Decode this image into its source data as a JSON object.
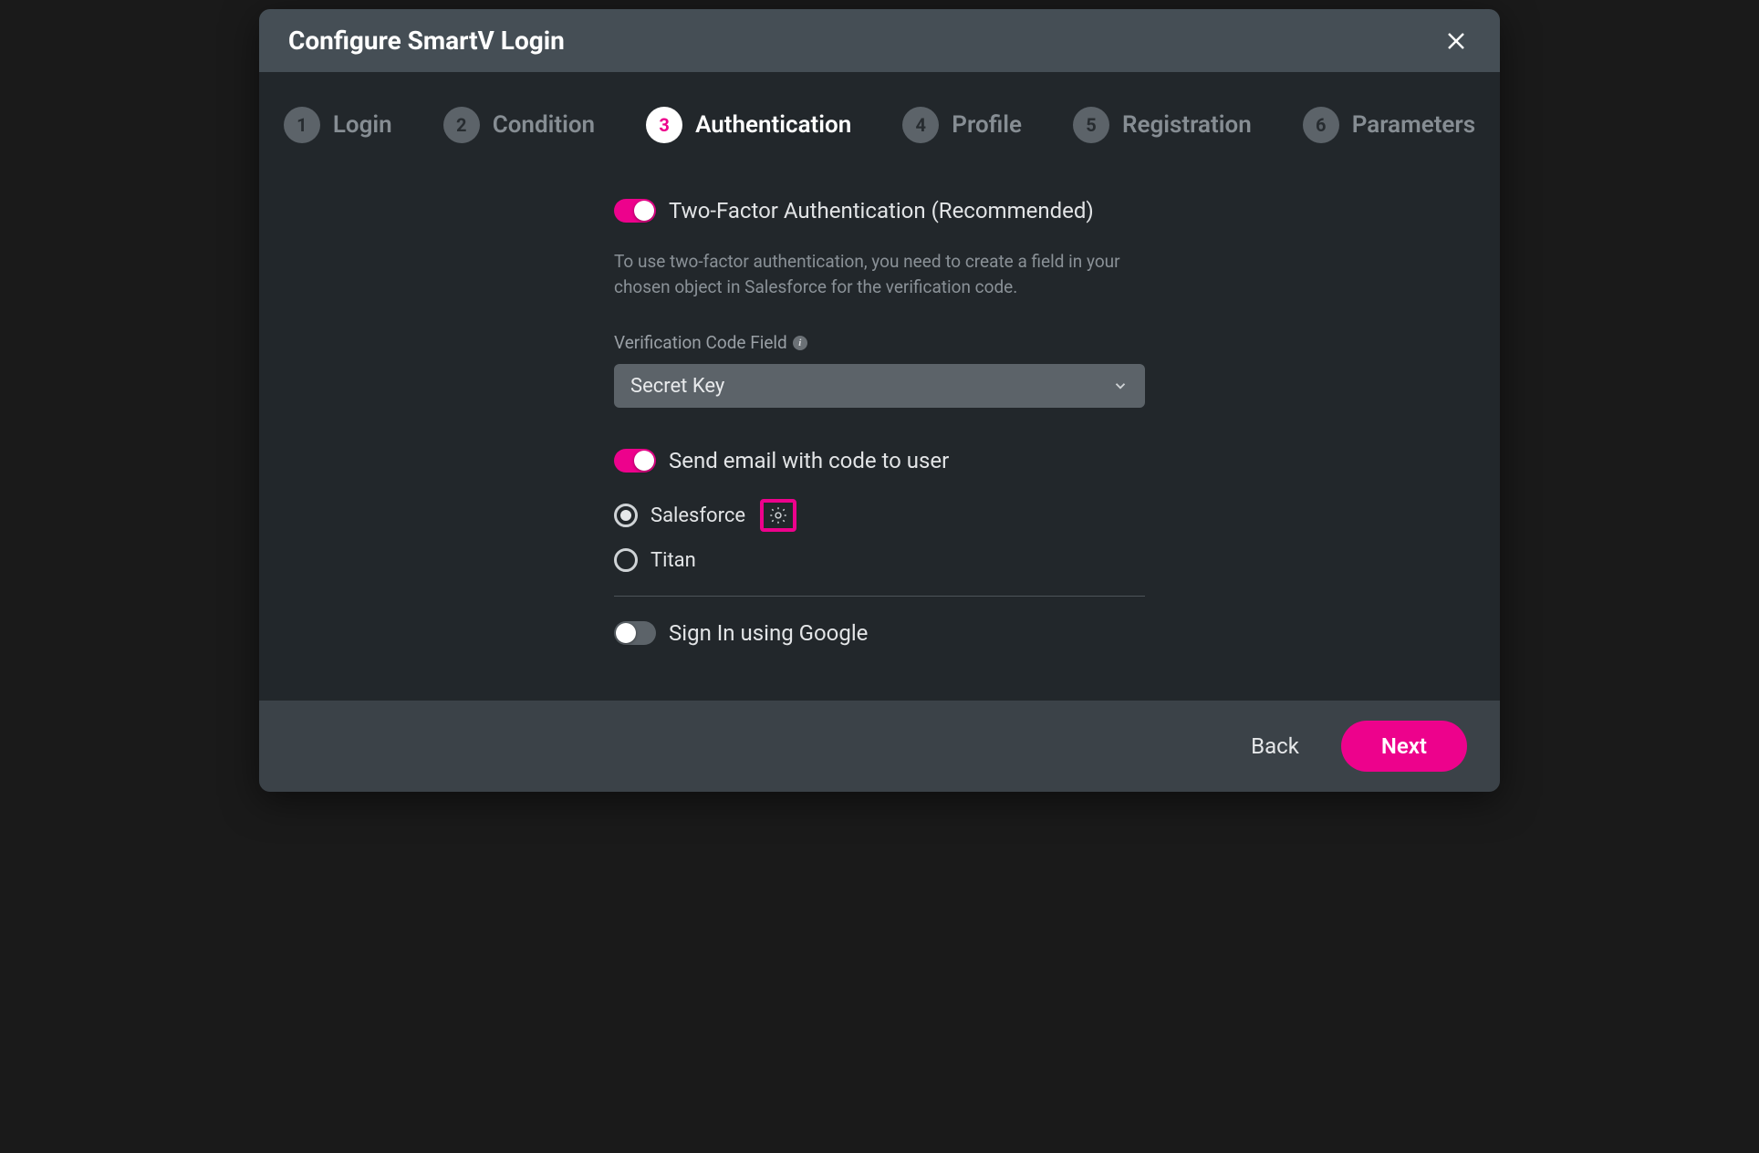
{
  "modal": {
    "title": "Configure SmartV Login"
  },
  "steps": [
    {
      "num": "1",
      "label": "Login"
    },
    {
      "num": "2",
      "label": "Condition"
    },
    {
      "num": "3",
      "label": "Authentication"
    },
    {
      "num": "4",
      "label": "Profile"
    },
    {
      "num": "5",
      "label": "Registration"
    },
    {
      "num": "6",
      "label": "Parameters"
    }
  ],
  "active_step_index": 2,
  "auth": {
    "two_factor_label": "Two-Factor Authentication (Recommended)",
    "two_factor_on": true,
    "helper_text": "To use two-factor authentication, you need to create a field in your chosen object in Salesforce for the verification code.",
    "field_label": "Verification Code Field",
    "field_value": "Secret Key",
    "send_email_label": "Send email with code to user",
    "send_email_on": true,
    "provider_options": [
      {
        "id": "salesforce",
        "label": "Salesforce",
        "selected": true,
        "has_gear": true
      },
      {
        "id": "titan",
        "label": "Titan",
        "selected": false,
        "has_gear": false
      }
    ],
    "google_signin_label": "Sign In using Google",
    "google_signin_on": false
  },
  "footer": {
    "back": "Back",
    "next": "Next"
  }
}
